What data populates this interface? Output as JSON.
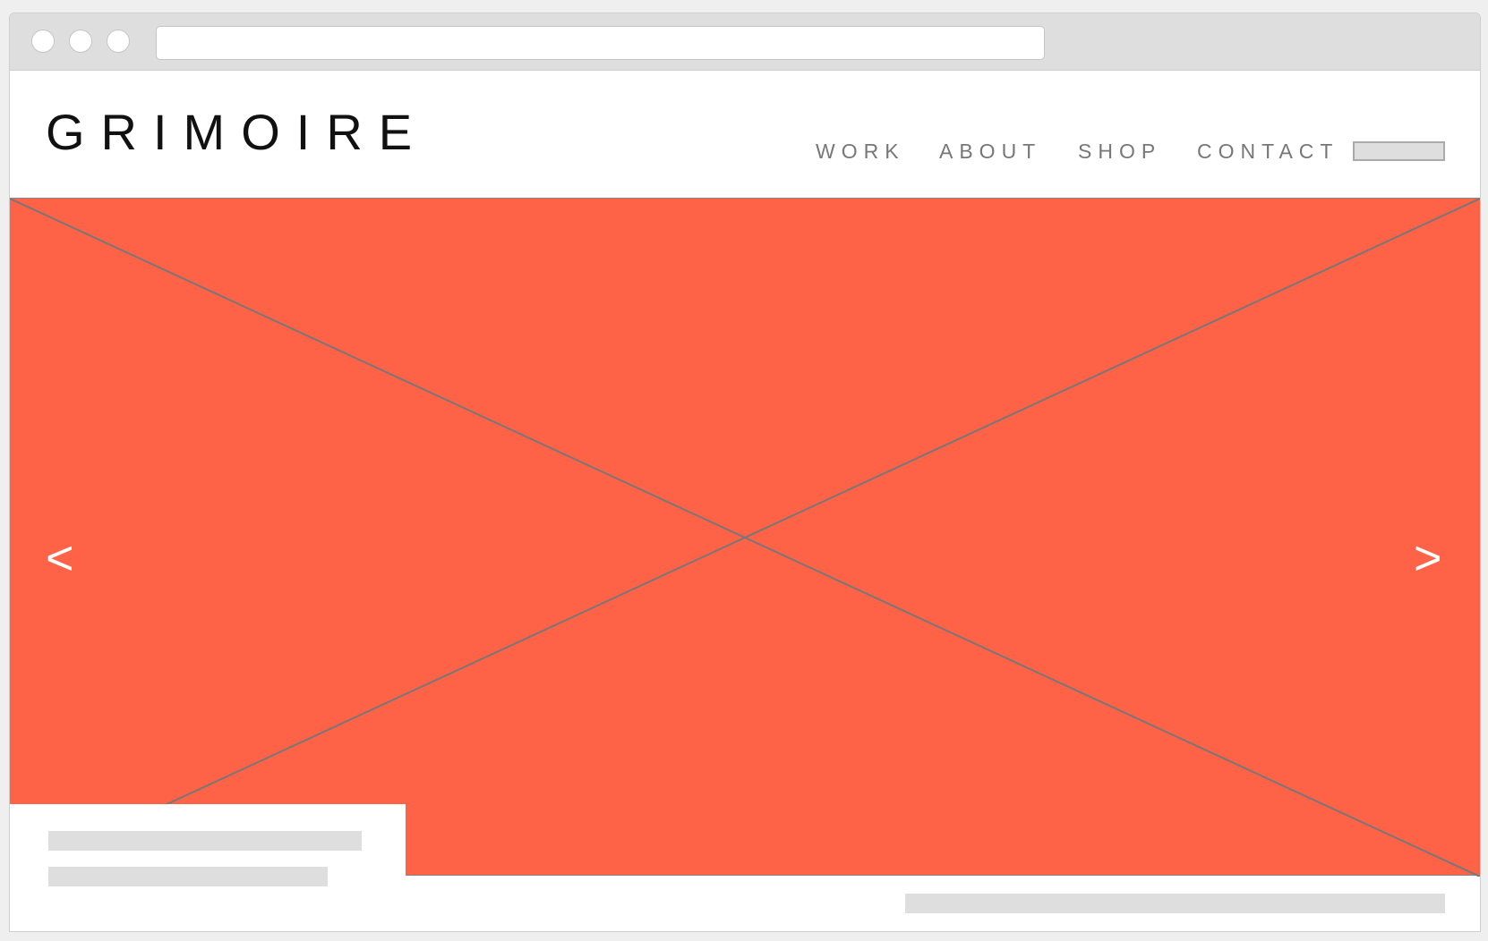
{
  "brand": {
    "logo_text": "GRIMOIRE"
  },
  "nav": {
    "items": [
      {
        "label": "WORK"
      },
      {
        "label": "ABOUT"
      },
      {
        "label": "SHOP"
      },
      {
        "label": "CONTACT"
      }
    ]
  },
  "slider": {
    "prev_label": "<",
    "next_label": ">"
  },
  "colors": {
    "hero_background": "#ff6347",
    "chrome_background": "#dedede",
    "placeholder": "#dedede"
  }
}
